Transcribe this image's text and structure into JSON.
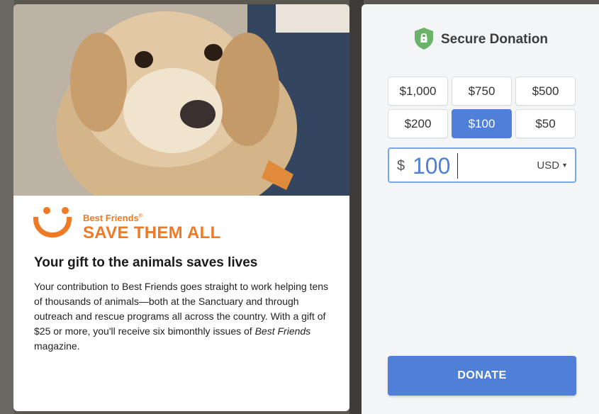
{
  "story": {
    "logo_brand": "Best Friends",
    "logo_reg": "®",
    "logo_tagline": "SAVE THEM ALL",
    "headline": "Your gift to the animals saves lives",
    "body_part1": "Your contribution to Best Friends goes straight to work helping tens of thousands of animals—both at the Sanctuary and through outreach and rescue programs all across the country. With a gift of $25 or more, you'll receive six bimonthly issues of ",
    "body_em": "Best Friends",
    "body_part2": " magazine."
  },
  "donation": {
    "title": "Secure Donation",
    "amounts": [
      "$1,000",
      "$750",
      "$500",
      "$200",
      "$100",
      "$50"
    ],
    "selected_amount": "$100",
    "currency_symbol": "$",
    "custom_value": "100",
    "currency": "USD",
    "donate_label": "DONATE"
  },
  "colors": {
    "accent": "#4f7fd6",
    "brand_orange": "#ef7a25",
    "shield_green": "#6bb36b"
  }
}
